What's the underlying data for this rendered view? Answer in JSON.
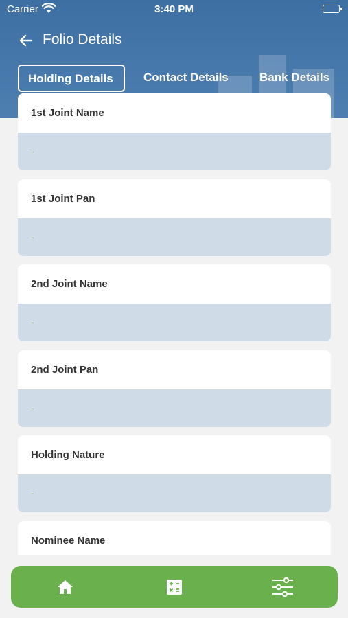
{
  "status": {
    "carrier": "Carrier",
    "time": "3:40 PM"
  },
  "header": {
    "title": "Folio Details"
  },
  "tabs": [
    {
      "label": "Holding Details",
      "active": true
    },
    {
      "label": "Contact Details",
      "active": false
    },
    {
      "label": "Bank Details",
      "active": false
    }
  ],
  "fields": [
    {
      "label": "1st Joint Name",
      "value": "-"
    },
    {
      "label": "1st Joint Pan",
      "value": "-"
    },
    {
      "label": "2nd Joint Name",
      "value": "-"
    },
    {
      "label": "2nd Joint Pan",
      "value": "-"
    },
    {
      "label": "Holding Nature",
      "value": "-"
    },
    {
      "label": "Nominee Name",
      "value": ""
    }
  ],
  "bottom_nav": {
    "items": [
      {
        "icon": "home-icon"
      },
      {
        "icon": "calculator-icon"
      },
      {
        "icon": "sliders-icon"
      }
    ]
  },
  "colors": {
    "header": "#3d6fa3",
    "bottom_nav": "#6ab04c",
    "value_bg": "#cfdce7",
    "value_text": "#8aa06c"
  }
}
